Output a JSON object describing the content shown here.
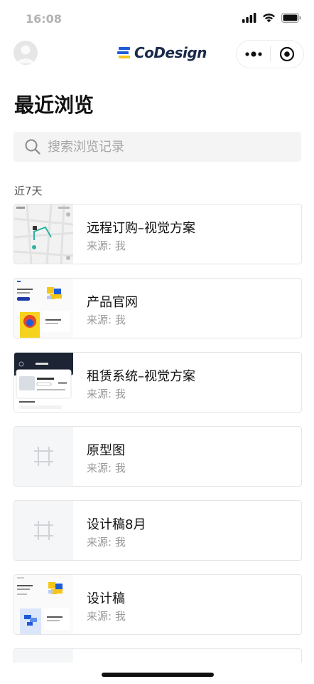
{
  "status_bar": {
    "time": "16:08"
  },
  "nav": {
    "logo_text": "CoDesign"
  },
  "page_title": "最近浏览",
  "search": {
    "placeholder": "搜索浏览记录"
  },
  "section_label": "近7天",
  "items": [
    {
      "title": "远程订购–视觉方案",
      "source": "来源: 我",
      "thumb": "map-screenshot"
    },
    {
      "title": "产品官网",
      "source": "来源: 我",
      "thumb": "website-screenshot"
    },
    {
      "title": "租赁系统–视觉方案",
      "source": "来源: 我",
      "thumb": "booking-screenshot"
    },
    {
      "title": "原型图",
      "source": "来源: 我",
      "thumb": "frame-icon"
    },
    {
      "title": "设计稿8月",
      "source": "来源: 我",
      "thumb": "frame-icon"
    },
    {
      "title": "设计稿",
      "source": "来源: 我",
      "thumb": "website-screenshot"
    }
  ],
  "colors": {
    "accent_blue": "#1e5bd8",
    "accent_yellow": "#f5c518",
    "text_primary": "#111111",
    "text_secondary": "#9a9a9a"
  }
}
